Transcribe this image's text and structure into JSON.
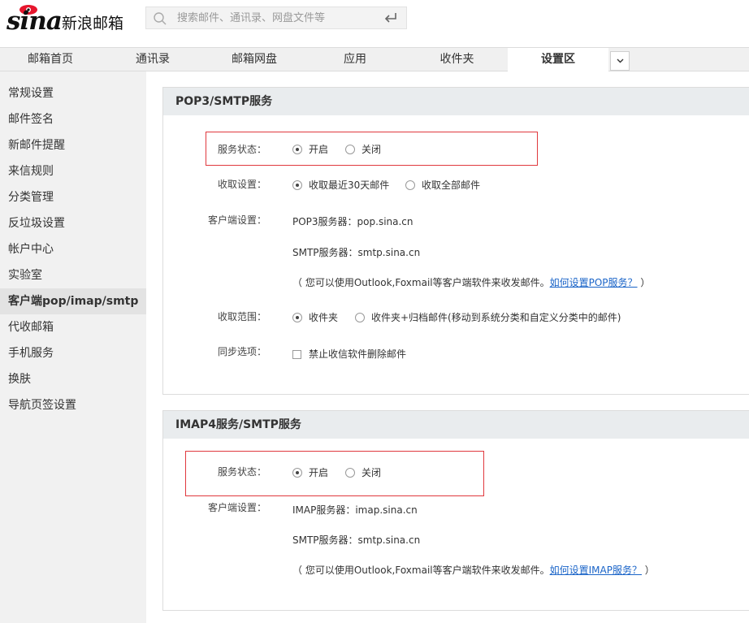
{
  "header": {
    "logo_text": "sina",
    "brand": "新浪邮箱",
    "search_placeholder": "搜索邮件、通讯录、网盘文件等"
  },
  "tabs": [
    {
      "label": "邮箱首页"
    },
    {
      "label": "通讯录"
    },
    {
      "label": "邮箱网盘"
    },
    {
      "label": "应用"
    },
    {
      "label": "收件夹"
    },
    {
      "label": "设置区"
    }
  ],
  "sidebar": {
    "items": [
      {
        "label": "常规设置"
      },
      {
        "label": "邮件签名"
      },
      {
        "label": "新邮件提醒"
      },
      {
        "label": "来信规则"
      },
      {
        "label": "分类管理"
      },
      {
        "label": "反垃圾设置"
      },
      {
        "label": "帐户中心"
      },
      {
        "label": "实验室"
      },
      {
        "label": "客户端pop/imap/smtp"
      },
      {
        "label": "代收邮箱"
      },
      {
        "label": "手机服务"
      },
      {
        "label": "换肤"
      },
      {
        "label": "导航页签设置"
      }
    ]
  },
  "pop3": {
    "title": "POP3/SMTP服务",
    "status_label": "服务状态：",
    "status_on": "开启",
    "status_off": "关闭",
    "fetch_label": "收取设置：",
    "fetch_recent": "收取最近30天邮件",
    "fetch_all": "收取全部邮件",
    "client_label": "客户端设置：",
    "pop3_server": "POP3服务器：pop.sina.cn",
    "smtp_server": "SMTP服务器：smtp.sina.cn",
    "note_prefix": "（ 您可以使用Outlook,Foxmail等客户端软件来收发邮件。",
    "note_link": "如何设置POP服务？",
    "note_suffix": " ）",
    "range_label": "收取范围：",
    "range_inbox": "收件夹",
    "range_inbox_archive": "收件夹+归档邮件(移动到系统分类和自定义分类中的邮件)",
    "sync_label": "同步选项：",
    "sync_option": "禁止收信软件删除邮件"
  },
  "imap": {
    "title": "IMAP4服务/SMTP服务",
    "status_label": "服务状态：",
    "status_on": "开启",
    "status_off": "关闭",
    "client_label": "客户端设置：",
    "imap_server": "IMAP服务器：imap.sina.cn",
    "smtp_server": "SMTP服务器：smtp.sina.cn",
    "note_prefix": "（ 您可以使用Outlook,Foxmail等客户端软件来收发邮件。",
    "note_link": "如何设置IMAP服务？",
    "note_suffix": " ）"
  },
  "colors": {
    "highlight_border": "#e0393e",
    "link": "#1a64c8",
    "panel_header": "#e9ecee",
    "sidebar_bg": "#f1f1f1"
  }
}
